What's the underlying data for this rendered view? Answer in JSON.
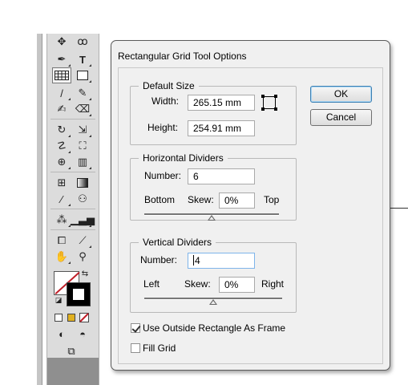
{
  "dialog": {
    "title": "Rectangular Grid Tool Options",
    "default_size": {
      "legend": "Default Size",
      "width_label": "Width:",
      "width_value": "265.15 mm",
      "height_label": "Height:",
      "height_value": "254.91 mm",
      "reference_point_icon": "reference-point-icon"
    },
    "horizontal_dividers": {
      "legend": "Horizontal Dividers",
      "number_label": "Number:",
      "number_value": "6",
      "left_label": "Bottom",
      "skew_label": "Skew:",
      "skew_value": "0%",
      "right_label": "Top",
      "skew_position": 0.5
    },
    "vertical_dividers": {
      "legend": "Vertical Dividers",
      "number_label": "Number:",
      "number_value": "4",
      "left_label": "Left",
      "skew_label": "Skew:",
      "skew_value": "0%",
      "right_label": "Right",
      "skew_position": 0.5
    },
    "use_outside_rectangle": {
      "label": "Use Outside Rectangle As Frame",
      "checked": true
    },
    "fill_grid": {
      "label": "Fill Grid",
      "checked": false
    },
    "ok_label": "OK",
    "cancel_label": "Cancel"
  },
  "toolbox": {
    "type_tool_glyph": "T",
    "selected_tool": "rectangular-grid-tool",
    "fill_color": "#ffffff",
    "stroke_color": "#000000",
    "none_color": "#c0202a"
  }
}
